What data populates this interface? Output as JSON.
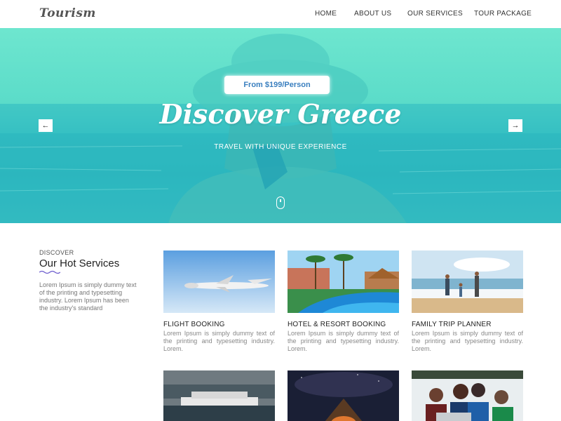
{
  "header": {
    "logo": "Tourism",
    "nav": [
      "HOME",
      "ABOUT US",
      "OUR SERVICES",
      "TOUR PACKAGE"
    ]
  },
  "hero": {
    "price": "From $199/Person",
    "title": "Discover Greece",
    "subtitle": "TRAVEL WITH UNIQUE EXPERIENCE",
    "prev_icon": "arrow-left-icon",
    "next_icon": "arrow-right-icon",
    "scroll_icon": "mouse-scroll-icon"
  },
  "services": {
    "label": "DISCOVER",
    "title": "Our Hot Services",
    "description": "Lorem Ipsum is simply dummy text of the printing and typesetting industry. Lorem Ipsum has been the industry's standard",
    "cards": [
      {
        "title": "FLIGHT BOOKING",
        "text": "Lorem Ipsum is simply dummy text of the printing and typesetting industry. Lorem."
      },
      {
        "title": "HOTEL & RESORT BOOKING",
        "text": "Lorem Ipsum is simply dummy text of the printing and typesetting industry. Lorem."
      },
      {
        "title": "FAMILY TRIP PLANNER",
        "text": "Lorem Ipsum is simply dummy text of the printing and typesetting industry. Lorem."
      }
    ]
  },
  "colors": {
    "hero_teal": "#4fd3c8",
    "price_text": "#3a7fbf",
    "squiggle": "#6a5acd"
  }
}
